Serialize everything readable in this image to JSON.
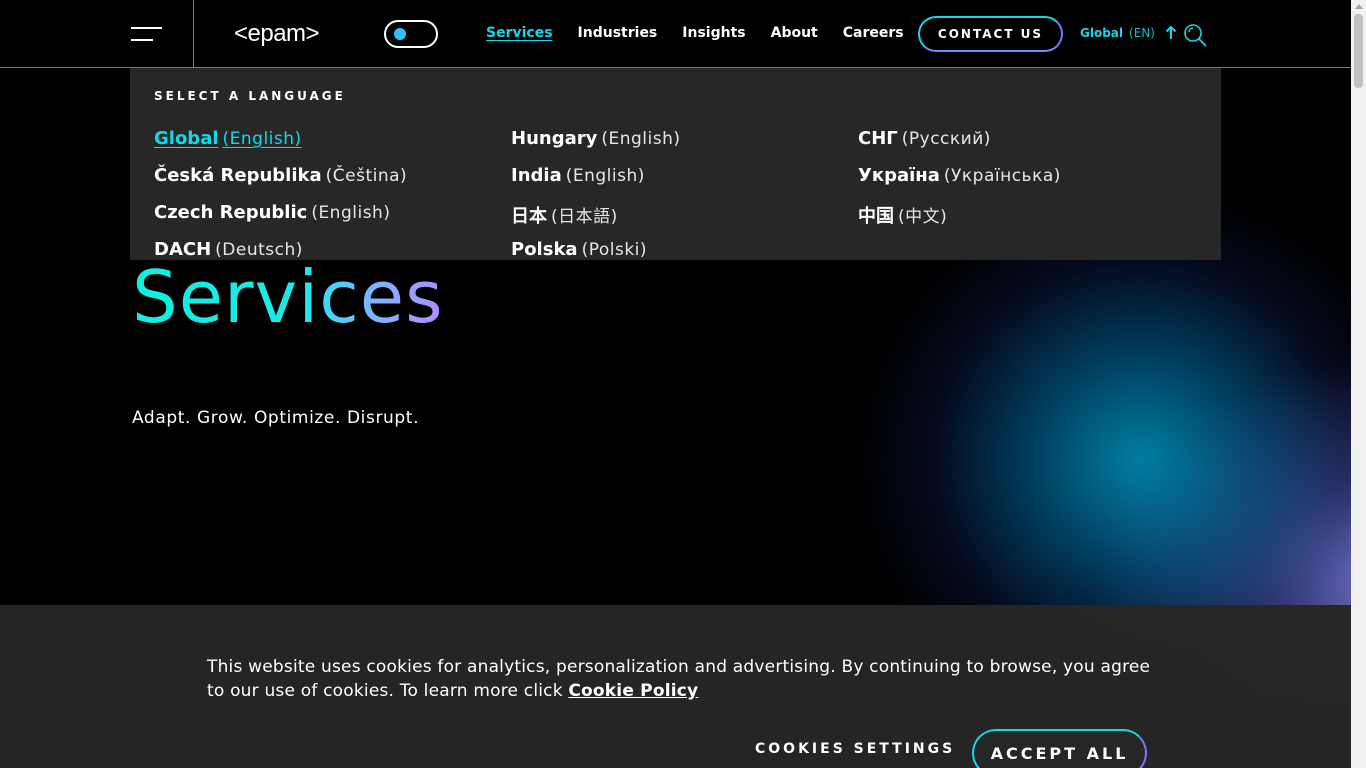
{
  "header": {
    "logo": "<epam>",
    "nav": [
      "Services",
      "Industries",
      "Insights",
      "About",
      "Careers"
    ],
    "active_nav": "Services",
    "contact_label": "CONTACT US",
    "lang_region": "Global",
    "lang_code": "(EN)"
  },
  "language_panel": {
    "heading": "SELECT A LANGUAGE",
    "columns": [
      [
        {
          "country": "Global",
          "lang": "(English)",
          "selected": true
        },
        {
          "country": "Česká Republika",
          "lang": "(Čeština)"
        },
        {
          "country": "Czech Republic",
          "lang": "(English)"
        },
        {
          "country": "DACH",
          "lang": "(Deutsch)"
        }
      ],
      [
        {
          "country": "Hungary",
          "lang": "(English)"
        },
        {
          "country": "India",
          "lang": "(English)"
        },
        {
          "country": "日本",
          "lang": "(日本語)"
        },
        {
          "country": "Polska",
          "lang": "(Polski)"
        }
      ],
      [
        {
          "country": "СНГ",
          "lang": "(Русский)"
        },
        {
          "country": "Україна",
          "lang": "(Українська)"
        },
        {
          "country": "中国",
          "lang": "(中文)"
        }
      ]
    ]
  },
  "hero": {
    "title": "Services",
    "subtitle": "Adapt. Grow. Optimize. Disrupt."
  },
  "cookie_banner": {
    "text": "This website uses cookies for analytics, personalization and advertising. By continuing to browse, you agree to our use of cookies. To learn more click ",
    "link": "Cookie Policy",
    "settings_label": "COOKIES SETTINGS",
    "accept_label": "ACCEPT ALL"
  },
  "colors": {
    "accent": "#14d8e6",
    "accent_violet": "#8a6ff5",
    "panel_bg": "#272727",
    "background": "#000000"
  }
}
